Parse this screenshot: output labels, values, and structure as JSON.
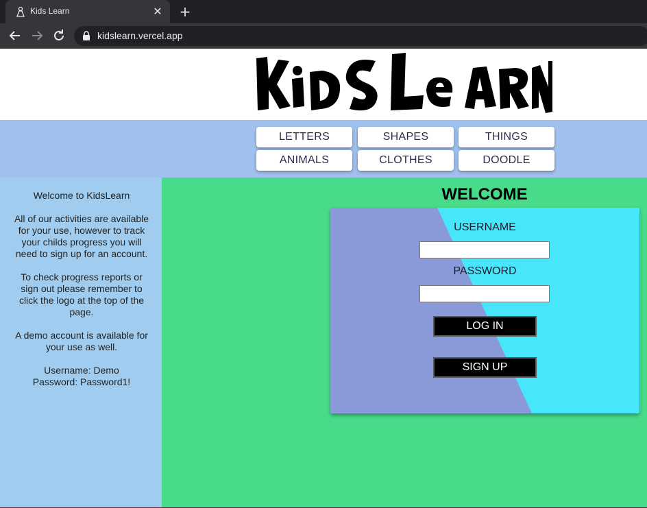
{
  "browser": {
    "tab_title": "Kids Learn",
    "url": "kidslearn.vercel.app"
  },
  "site": {
    "logo_text": "KiDS LeARN"
  },
  "nav": {
    "items": [
      "LETTERS",
      "SHAPES",
      "THINGS",
      "ANIMALS",
      "CLOTHES",
      "DOODLE"
    ]
  },
  "sidebar": {
    "welcome": "Welcome to KidsLearn",
    "intro": "All of our activities are available for your use, however to track your childs progress you will need to sign up for an account.",
    "progress_note": "To check progress reports or sign out please remember to click the logo at the top of the page.",
    "demo_note": "A demo account is available for your use as well.",
    "demo_username": "Username: Demo",
    "demo_password": "Password: Password1!"
  },
  "login": {
    "heading": "WELCOME",
    "username_label": "USERNAME",
    "username_value": "",
    "password_label": "PASSWORD",
    "password_value": "",
    "login_button": "LOG IN",
    "signup_button": "SIGN UP"
  },
  "colors": {
    "navbar": "#a0c1ee",
    "sidebar": "#a0cdef",
    "main": "#48dc8a",
    "card_left": "#8a9ad8",
    "card_right": "#48e6fb"
  }
}
